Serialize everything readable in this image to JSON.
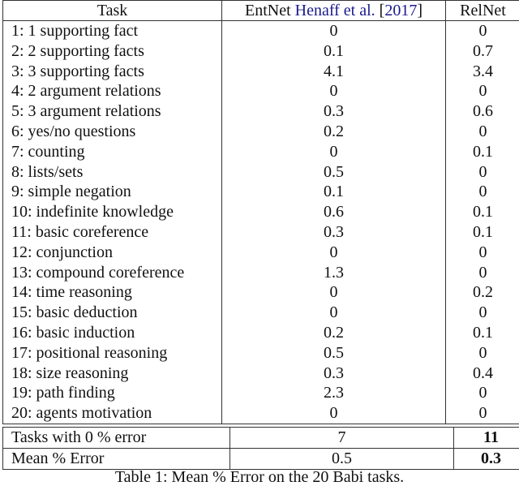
{
  "table": {
    "headers": {
      "task": "Task",
      "entnet_prefix": "EntNet ",
      "entnet_cite_authors": "Henaff et al.",
      "entnet_cite_open": " [",
      "entnet_cite_year": "2017",
      "entnet_cite_close": "]",
      "relnet": "RelNet"
    },
    "citation_color": "#1a1a8c",
    "rows": [
      {
        "task": "1: 1 supporting fact",
        "entnet": "0",
        "relnet": "0"
      },
      {
        "task": "2: 2 supporting facts",
        "entnet": "0.1",
        "relnet": "0.7"
      },
      {
        "task": "3: 3 supporting facts",
        "entnet": "4.1",
        "relnet": "3.4"
      },
      {
        "task": "4: 2 argument relations",
        "entnet": "0",
        "relnet": "0"
      },
      {
        "task": "5: 3 argument relations",
        "entnet": "0.3",
        "relnet": "0.6"
      },
      {
        "task": "6: yes/no questions",
        "entnet": "0.2",
        "relnet": "0"
      },
      {
        "task": "7: counting",
        "entnet": "0",
        "relnet": "0.1"
      },
      {
        "task": "8: lists/sets",
        "entnet": "0.5",
        "relnet": "0"
      },
      {
        "task": "9: simple negation",
        "entnet": "0.1",
        "relnet": "0"
      },
      {
        "task": "10: indefinite knowledge",
        "entnet": "0.6",
        "relnet": "0.1"
      },
      {
        "task": "11: basic coreference",
        "entnet": "0.3",
        "relnet": "0.1"
      },
      {
        "task": "12: conjunction",
        "entnet": "0",
        "relnet": "0"
      },
      {
        "task": "13: compound coreference",
        "entnet": "1.3",
        "relnet": "0"
      },
      {
        "task": "14: time reasoning",
        "entnet": "0",
        "relnet": "0.2"
      },
      {
        "task": "15: basic deduction",
        "entnet": "0",
        "relnet": "0"
      },
      {
        "task": "16: basic induction",
        "entnet": "0.2",
        "relnet": "0.1"
      },
      {
        "task": "17: positional reasoning",
        "entnet": "0.5",
        "relnet": "0"
      },
      {
        "task": "18: size reasoning",
        "entnet": "0.3",
        "relnet": "0.4"
      },
      {
        "task": "19: path finding",
        "entnet": "2.3",
        "relnet": "0"
      },
      {
        "task": "20: agents motivation",
        "entnet": "0",
        "relnet": "0"
      }
    ],
    "summary": [
      {
        "label": "Tasks with 0 % error",
        "entnet": "7",
        "relnet": "11",
        "relnet_bold": true
      },
      {
        "label": "Mean % Error",
        "entnet": "0.5",
        "relnet": "0.3",
        "relnet_bold": true
      }
    ]
  },
  "caption": "Table 1: Mean % Error on the 20 Babi tasks."
}
